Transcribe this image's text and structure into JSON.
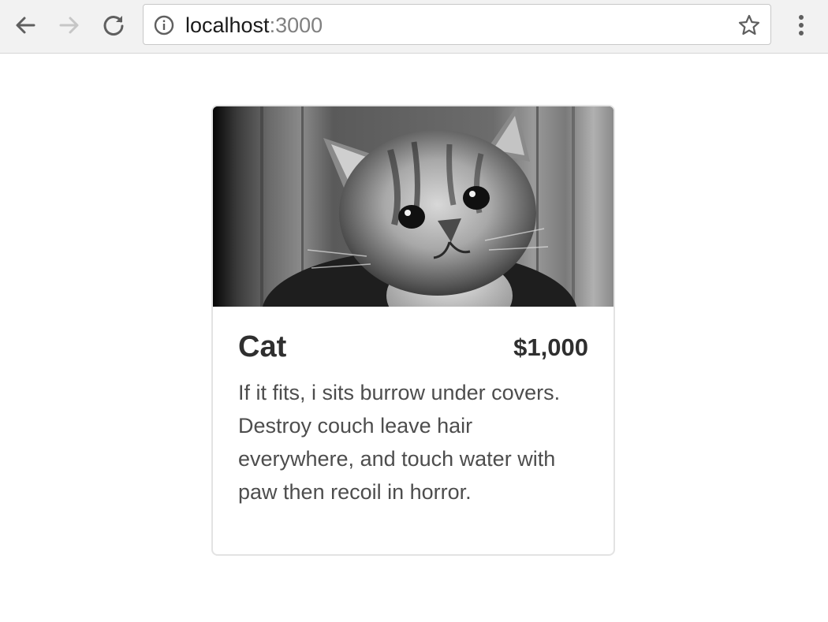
{
  "browser": {
    "url_host": "localhost",
    "url_port": ":3000",
    "icons": {
      "back": "arrow-left-icon",
      "forward": "arrow-right-icon",
      "reload": "reload-icon",
      "info": "info-icon",
      "bookmark": "star-icon",
      "menu": "vertical-dots-icon"
    }
  },
  "card": {
    "image_subject": "kitten photo (grayscale)",
    "title": "Cat",
    "price": "$1,000",
    "description": "If it fits, i sits burrow under covers. Destroy couch leave hair everywhere, and touch water with paw then recoil in horror."
  },
  "colors": {
    "chrome_bg": "#f2f2f2",
    "text_dark": "#2f2f2f",
    "text_body": "#4d4d4d",
    "border": "#e3e3e3"
  }
}
